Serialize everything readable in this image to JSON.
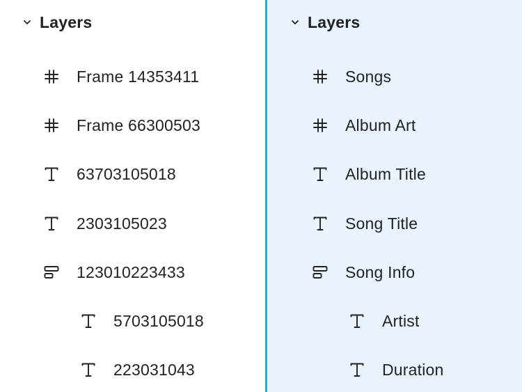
{
  "accent_colors": {
    "divider": "#29a8d8",
    "selected_panel_bg": "#e8f3fc"
  },
  "panels": [
    {
      "header": {
        "label": "Layers",
        "icon": "chevron-down-icon"
      },
      "layers": [
        {
          "label": "Frame 14353411",
          "icon": "frame-hash-icon",
          "indent": 0
        },
        {
          "label": "Frame 66300503",
          "icon": "frame-hash-icon",
          "indent": 0
        },
        {
          "label": "63703105018",
          "icon": "text-icon",
          "indent": 0
        },
        {
          "label": "2303105023",
          "icon": "text-icon",
          "indent": 0
        },
        {
          "label": "123010223433",
          "icon": "auto-layout-icon",
          "indent": 0
        },
        {
          "label": "5703105018",
          "icon": "text-icon",
          "indent": 1
        },
        {
          "label": "223031043",
          "icon": "text-icon",
          "indent": 1
        }
      ]
    },
    {
      "header": {
        "label": "Layers",
        "icon": "chevron-down-icon"
      },
      "layers": [
        {
          "label": "Songs",
          "icon": "frame-hash-icon",
          "indent": 0
        },
        {
          "label": "Album Art",
          "icon": "frame-hash-icon",
          "indent": 0
        },
        {
          "label": "Album Title",
          "icon": "text-icon",
          "indent": 0
        },
        {
          "label": "Song Title",
          "icon": "text-icon",
          "indent": 0
        },
        {
          "label": "Song Info",
          "icon": "auto-layout-icon",
          "indent": 0
        },
        {
          "label": "Artist",
          "icon": "text-icon",
          "indent": 1
        },
        {
          "label": "Duration",
          "icon": "text-icon",
          "indent": 1
        }
      ]
    }
  ]
}
